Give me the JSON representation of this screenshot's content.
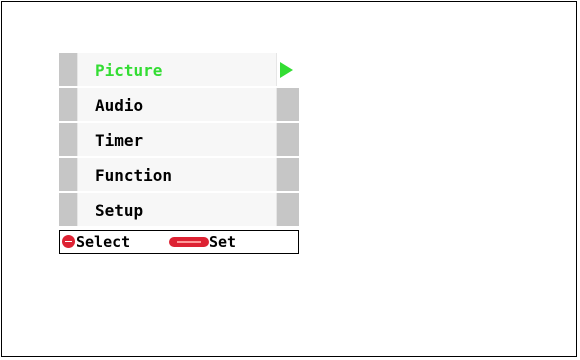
{
  "menu": {
    "items": [
      {
        "label": "Picture",
        "selected": true
      },
      {
        "label": "Audio",
        "selected": false
      },
      {
        "label": "Timer",
        "selected": false
      },
      {
        "label": "Function",
        "selected": false
      },
      {
        "label": "Setup",
        "selected": false
      }
    ],
    "selected_arrow_icon": "right-triangle-icon",
    "selected_color": "#33dd33"
  },
  "hint_bar": {
    "select_icon": "red-round-button-icon",
    "select_label": "Select",
    "set_icon": "red-enter-button-icon",
    "set_label": "Set",
    "icon_color": "#dd2233"
  }
}
